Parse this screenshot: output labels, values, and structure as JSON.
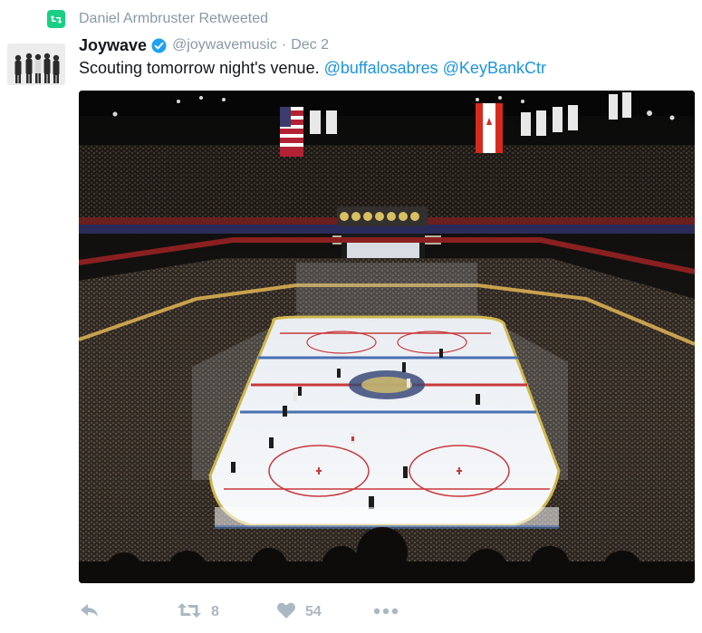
{
  "retweet_context": {
    "text": "Daniel Armbruster Retweeted"
  },
  "tweet": {
    "author": {
      "display_name": "Joywave",
      "handle": "@joywavemusic",
      "verified": true
    },
    "separator": "·",
    "timestamp": "Dec 2",
    "text": "Scouting tomorrow night's venue.",
    "mentions": [
      "@buffalosabres",
      "@KeyBankCtr"
    ],
    "media": {
      "description_icon": "hockey-arena-photo"
    }
  },
  "actions": {
    "reply": {
      "icon": "reply-icon"
    },
    "retweet": {
      "icon": "retweet-icon",
      "count": "8"
    },
    "like": {
      "icon": "heart-icon",
      "count": "54"
    },
    "more": {
      "icon": "more-icon"
    }
  },
  "colors": {
    "retweet_green": "#19cf86",
    "link_blue": "#1b95e0",
    "muted_gray": "#8899a6",
    "action_gray": "#aab8c2",
    "verified_blue": "#1da1f2"
  }
}
